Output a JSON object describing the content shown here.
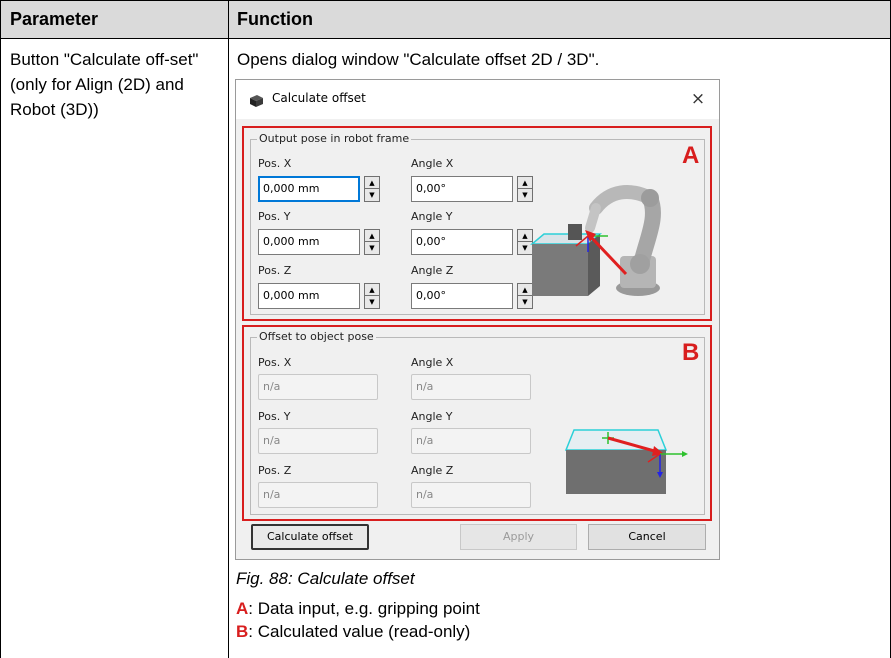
{
  "table": {
    "header_parameter": "Parameter",
    "header_function": "Function",
    "param_text": "Button \"Calculate off-set\" (only for Align (2D) and Robot (3D))",
    "function_text": "Opens dialog window \"Calculate offset 2D / 3D\"."
  },
  "dialog": {
    "app_icon": "camera-sensor-icon",
    "title": "Calculate offset",
    "close_glyph": "×",
    "group_a": {
      "title": "Output pose in robot frame",
      "letter": "A",
      "pos_x_label": "Pos. X",
      "pos_x_value": "0,000 mm",
      "pos_y_label": "Pos. Y",
      "pos_y_value": "0,000 mm",
      "pos_z_label": "Pos. Z",
      "pos_z_value": "0,000 mm",
      "angle_x_label": "Angle X",
      "angle_x_value": "0,00°",
      "angle_y_label": "Angle Y",
      "angle_y_value": "0,00°",
      "angle_z_label": "Angle Z",
      "angle_z_value": "0,00°"
    },
    "group_b": {
      "title": "Offset to object pose",
      "letter": "B",
      "pos_x_label": "Pos. X",
      "pos_x_value": "n/a",
      "pos_y_label": "Pos. Y",
      "pos_y_value": "n/a",
      "pos_z_label": "Pos. Z",
      "pos_z_value": "n/a",
      "angle_x_label": "Angle X",
      "angle_x_value": "n/a",
      "angle_y_label": "Angle Y",
      "angle_y_value": "n/a",
      "angle_z_label": "Angle Z",
      "angle_z_value": "n/a"
    },
    "buttons": {
      "calculate": "Calculate offset",
      "apply": "Apply",
      "cancel": "Cancel"
    }
  },
  "caption": "Fig. 88: Calculate offset",
  "legend": {
    "a_key": "A",
    "a_text": ": Data input, e.g. gripping point",
    "b_key": "B",
    "b_text": ": Calculated value (read-only)"
  },
  "colors": {
    "accent_red": "#d81e1e",
    "focus_blue": "#0078d7",
    "header_gray": "#dadada"
  }
}
